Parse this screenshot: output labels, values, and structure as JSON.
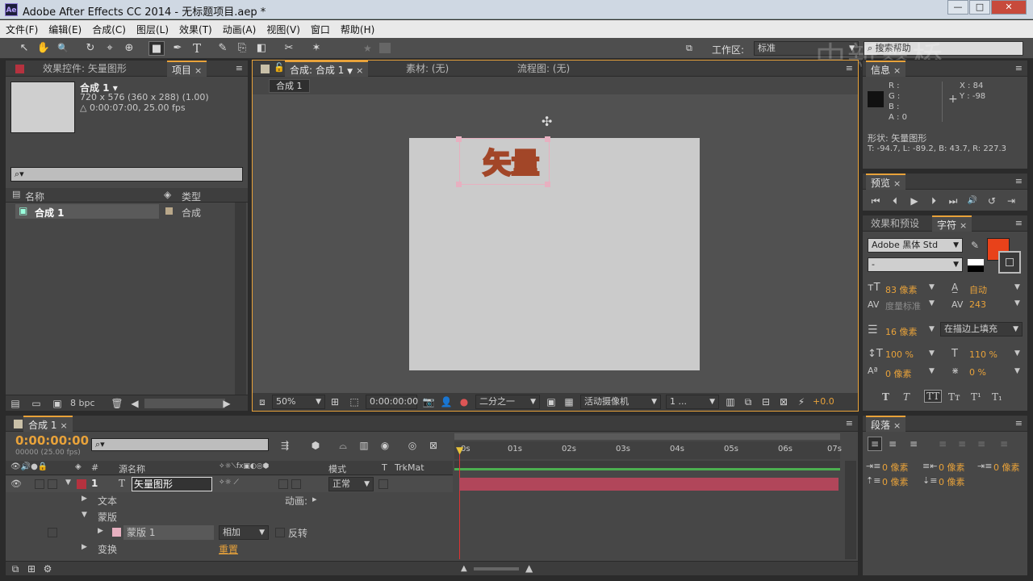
{
  "window": {
    "title": "Adobe After Effects CC 2014 - 无标题项目.aep *",
    "app_badge": "Ae",
    "btn_min": "—",
    "btn_max": "□",
    "btn_close": "✕"
  },
  "menu": [
    "文件(F)",
    "编辑(E)",
    "合成(C)",
    "图层(L)",
    "效果(T)",
    "动画(A)",
    "视图(V)",
    "窗口",
    "帮助(H)"
  ],
  "toolbar": {
    "workspace_label": "工作区:",
    "workspace_value": "标准",
    "search_placeholder": "搜索帮助",
    "tools": [
      "selection",
      "hand",
      "zoom",
      "rotate",
      "camera-orbit",
      "pan-behind",
      "rectangle",
      "pen",
      "type",
      "brush",
      "clone",
      "eraser",
      "roto",
      "puppet"
    ],
    "tool_glyphs": [
      "↖",
      "✋",
      "🔍",
      "↻",
      "⌖",
      "⊕",
      "■",
      "✒",
      "T",
      "✎",
      "⎘",
      "◧",
      "✂",
      "✶"
    ]
  },
  "watermark": "中新鑫桥",
  "left_panel": {
    "tabs": [
      {
        "label": "效果控件: 矢量图形"
      },
      {
        "label": "项目",
        "active": true
      }
    ],
    "comp_name": "合成 1 ▾",
    "comp_size": "720 x 576  (360 x 288) (1.00)",
    "comp_dur": "△ 0:00:07:00, 25.00 fps",
    "search_placeholder": "⌕▾",
    "columns": {
      "name": "名称",
      "type": "类型"
    },
    "items": [
      {
        "name": "合成 1",
        "type": "合成"
      }
    ],
    "bpc": "8 bpc"
  },
  "comp_panel": {
    "tabs": [
      {
        "label": "合成: 合成 1",
        "active": true
      },
      {
        "label": "素材: (无)"
      },
      {
        "label": "流程图: (无)"
      }
    ],
    "breadcrumb": "合成 1",
    "canvas_text": "矢量",
    "zoom": "50%",
    "timecode": "0:00:00:00",
    "resolution": "二分之一",
    "camera": "活动摄像机",
    "views": "1 ...",
    "offset": "+0.0"
  },
  "info_panel": {
    "tab": "信息",
    "r": "R :",
    "g": "G :",
    "b": "B :",
    "a": "A : 0",
    "x": "X : 84",
    "y": "Y : -98",
    "shape": "形状: 矢量图形",
    "bounds": "T: -94.7, L: -89.2, B: 43.7, R: 227.3"
  },
  "preview_panel": {
    "tab": "预览",
    "controls": [
      "⏮",
      "⏴",
      "▶",
      "⏵",
      "⏭",
      "🔊",
      "↺",
      "⇥"
    ]
  },
  "char_panel": {
    "tabs": [
      {
        "label": "效果和预设"
      },
      {
        "label": "字符",
        "active": true
      }
    ],
    "font": "Adobe 黑体 Std",
    "style": "-",
    "size": "83 像素",
    "leading": "自动",
    "kerning": "度量标准",
    "tracking": "243",
    "stroke": "16 像素",
    "stroke_mode": "在描边上填充",
    "vscale": "100 %",
    "hscale": "110 %",
    "baseline": "0 像素",
    "tsume": "0 %",
    "styles": [
      "T",
      "T",
      "TT",
      "Tт",
      "T¹",
      "T₁"
    ],
    "fill_color": "#e8421a",
    "stroke_color": "#3a3a3a"
  },
  "para_panel": {
    "tab": "段落",
    "indent_left": "0 像素",
    "indent_right": "0 像素",
    "indent_first": "0 像素",
    "space_before": "0 像素",
    "space_after": "0 像素"
  },
  "timeline": {
    "tab": "合成 1",
    "timecode": "0:00:00:00",
    "fps": "00000 (25.00 fps)",
    "search_placeholder": "⌕▾",
    "header": {
      "num": "#",
      "name": "源名称",
      "mode": "模式",
      "t": "T",
      "trkmat": "TrkMat"
    },
    "ruler": [
      "0s",
      "01s",
      "02s",
      "03s",
      "04s",
      "05s",
      "06s",
      "07s"
    ],
    "layer": {
      "num": "1",
      "name": "矢量图形",
      "mode": "正常"
    },
    "rows": {
      "text": "文本",
      "animate": "动画:",
      "masks": "蒙版",
      "mask1": "蒙版 1",
      "mask_mode": "相加",
      "invert": "反转",
      "transform": "变换",
      "reset": "重置"
    }
  }
}
